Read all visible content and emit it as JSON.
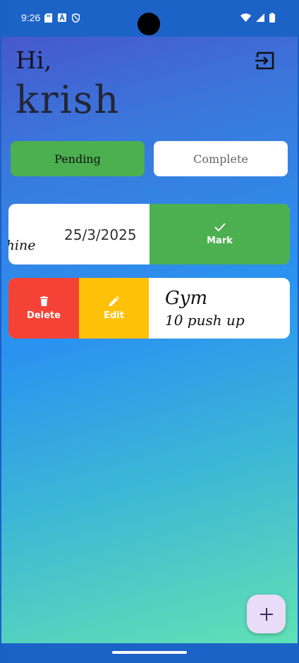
{
  "status": {
    "time": "9:26",
    "left_icons": [
      "sd-card-icon",
      "font-icon",
      "shield-icon"
    ],
    "right_icons": [
      "wifi-icon",
      "signal-icon",
      "battery-icon"
    ]
  },
  "header": {
    "greeting": "Hi,",
    "username": "krish",
    "logout_icon": "logout-icon"
  },
  "tabs": {
    "pending_label": "Pending",
    "complete_label": "Complete",
    "active": "Pending"
  },
  "tasks": [
    {
      "title_visible": "chine",
      "date": "25/3/2025",
      "action_label": "Mark",
      "action_icon": "check-icon"
    },
    {
      "title": "Gym",
      "description": "10 push up",
      "delete_label": "Delete",
      "delete_icon": "trash-icon",
      "edit_label": "Edit",
      "edit_icon": "pencil-icon"
    }
  ],
  "fab": {
    "icon": "plus-icon"
  },
  "colors": {
    "pending_tab": "#4caf50",
    "mark": "#4caf50",
    "delete": "#f44336",
    "edit": "#ffc107",
    "fab": "#e9dcf8"
  }
}
